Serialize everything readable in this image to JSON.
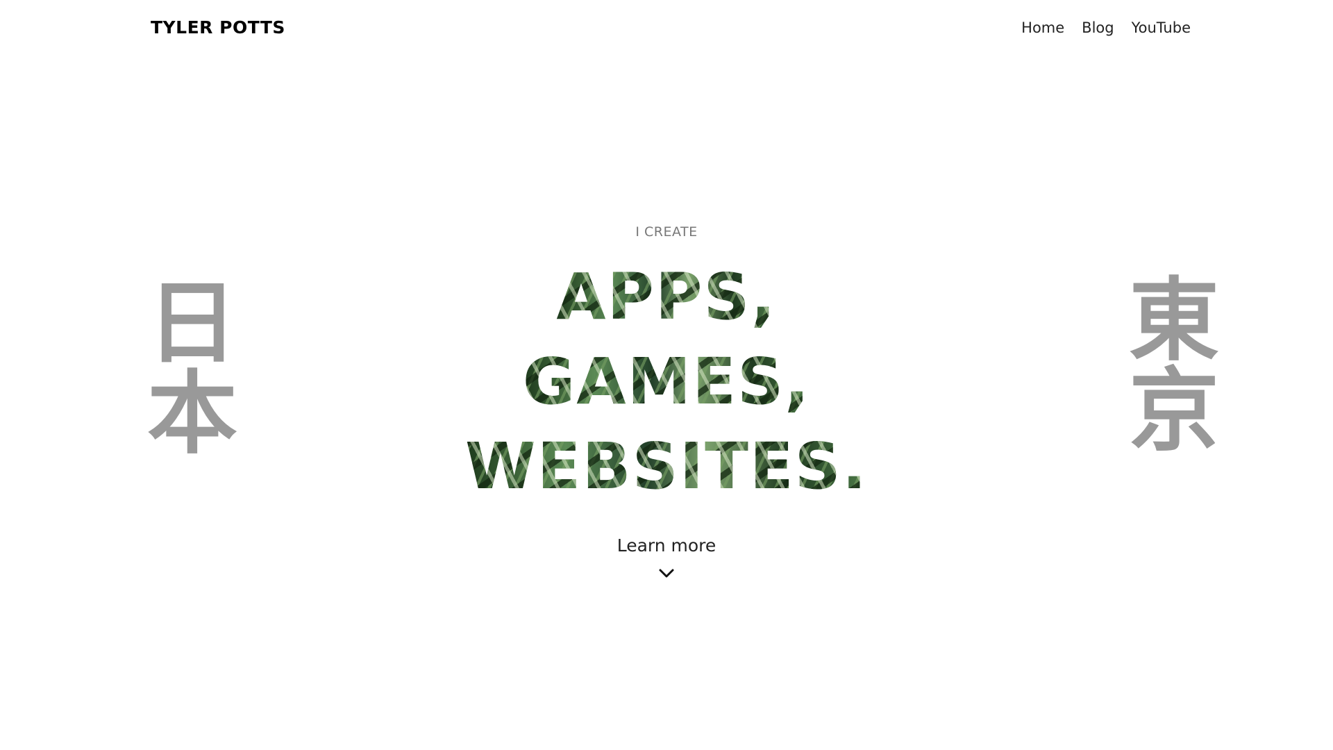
{
  "header": {
    "brand": "TYLER POTTS",
    "nav": [
      "Home",
      "Blog",
      "YouTube"
    ]
  },
  "side": {
    "left": "日本",
    "right": "東京"
  },
  "hero": {
    "eyebrow": "I CREATE",
    "lines": [
      "APPS,",
      "GAMES,",
      "WEBSITES."
    ],
    "cta": "Learn more",
    "cta_icon": "chevron-down-icon"
  },
  "colors": {
    "text": "#222222",
    "brand": "#000000",
    "eyebrow": "#777777",
    "kanji": "#999999",
    "background": "#ffffff",
    "headline_fill": "#2f4f2b"
  }
}
